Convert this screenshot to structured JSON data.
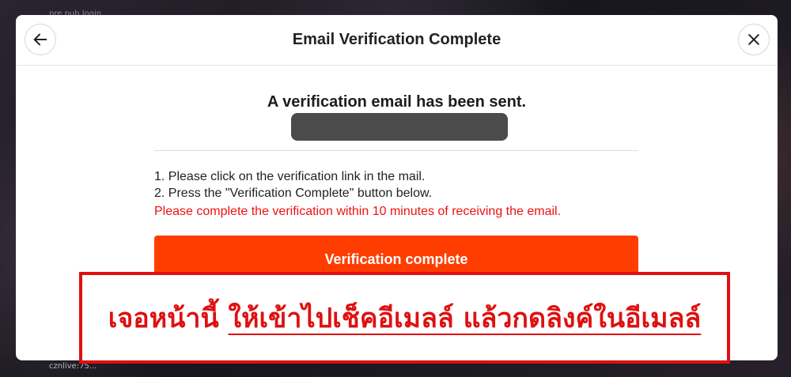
{
  "background": {
    "top_text": "pre pub login",
    "bottom_text": "cznlive:75..."
  },
  "dialog": {
    "title": "Email Verification Complete",
    "back_icon": "arrow-left-icon",
    "close_icon": "close-x-icon",
    "heading": "A verification email has been sent.",
    "email_value_redacted": true,
    "instructions": [
      "1. Please click on the verification link in the mail.",
      "2. Press the \"Verification Complete\" button below."
    ],
    "warning": "Please complete the verification within 10 minutes of receiving the email.",
    "verify_button_label": "Verification complete"
  },
  "annotation": {
    "text_part1": "เจอหน้านี้ ",
    "text_part2": "ให้เข้าไปเช็คอีเมลล์ แล้วกดลิงค์ในอีเมลล์"
  },
  "colors": {
    "accent_button": "#ff3d00",
    "warning_text": "#ee1111",
    "annotation_red": "#e01010",
    "redaction": "#4b4b4b"
  }
}
